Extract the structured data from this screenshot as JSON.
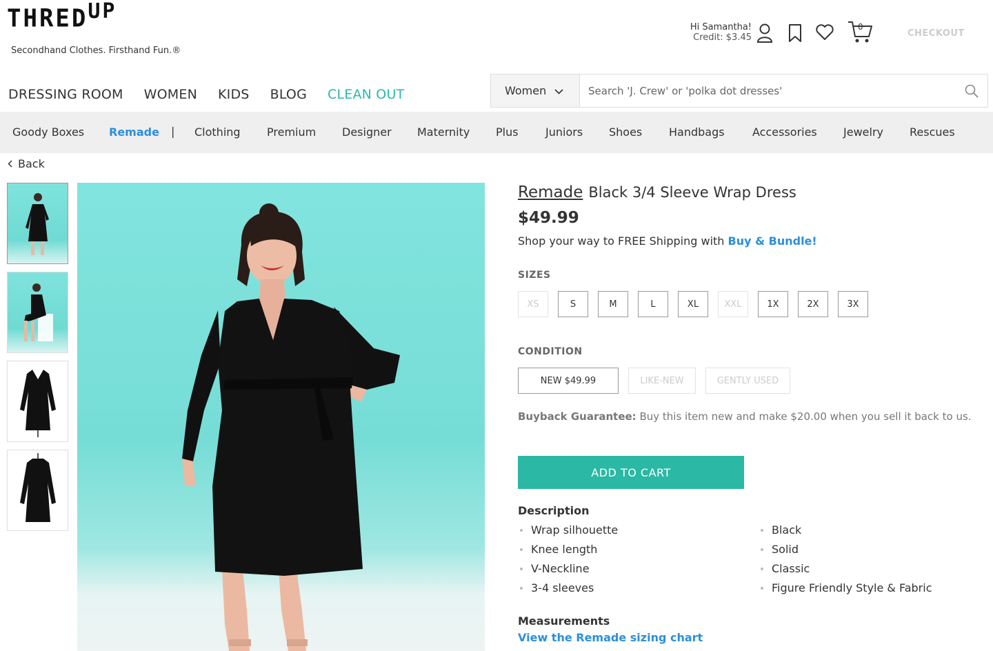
{
  "brand": {
    "logo_main": "THRED",
    "logo_super": "UP",
    "tagline": "Secondhand Clothes. Firsthand Fun.®"
  },
  "account": {
    "greeting": "Hi Samantha!",
    "credit": "Credit: $3.45",
    "cart_count": "0",
    "checkout_label": "CHECKOUT"
  },
  "main_nav": [
    {
      "label": "DRESSING ROOM"
    },
    {
      "label": "WOMEN"
    },
    {
      "label": "KIDS"
    },
    {
      "label": "BLOG"
    },
    {
      "label": "CLEAN OUT",
      "accent": "#2bb8aa"
    }
  ],
  "search": {
    "category": "Women",
    "placeholder": "Search 'J. Crew' or 'polka dot dresses'"
  },
  "category_bar": {
    "items": [
      "Goody Boxes",
      "Remade",
      "Clothing",
      "Premium",
      "Designer",
      "Maternity",
      "Plus",
      "Juniors",
      "Shoes",
      "Handbags",
      "Accessories",
      "Jewelry",
      "Rescues"
    ],
    "separator": "|",
    "active_color": "#2b8fdc"
  },
  "back_label": "Back",
  "product": {
    "brand": "Remade",
    "name": "Black 3/4 Sleeve Wrap Dress",
    "price": "$49.99",
    "shipping_text": "Shop your way to FREE Shipping with ",
    "shipping_link": "Buy & Bundle!",
    "sizes_label": "SIZES",
    "sizes": [
      {
        "label": "XS",
        "available": false
      },
      {
        "label": "S",
        "available": true
      },
      {
        "label": "M",
        "available": true
      },
      {
        "label": "L",
        "available": true
      },
      {
        "label": "XL",
        "available": true
      },
      {
        "label": "XXL",
        "available": false
      },
      {
        "label": "1X",
        "available": true
      },
      {
        "label": "2X",
        "available": true
      },
      {
        "label": "3X",
        "available": true
      }
    ],
    "condition_label": "CONDITION",
    "conditions": [
      {
        "label": "NEW $49.99",
        "available": true
      },
      {
        "label": "LIKE-NEW",
        "available": false
      },
      {
        "label": "GENTLY USED",
        "available": false
      }
    ],
    "buyback_label": "Buyback Guarantee:",
    "buyback_text": " Buy this item new and make $20.00 when you sell it back to us.",
    "add_to_cart": "ADD TO CART",
    "description_title": "Description",
    "description_left": [
      "Wrap silhouette",
      "Knee length",
      "V-Neckline",
      "3-4 sleeves"
    ],
    "description_right": [
      "Black",
      "Solid",
      "Classic",
      "Figure Friendly Style & Fabric"
    ],
    "measurements_title": "Measurements",
    "measurements_link": "View the Remade sizing chart",
    "accent_color": "#2bb8a4"
  }
}
